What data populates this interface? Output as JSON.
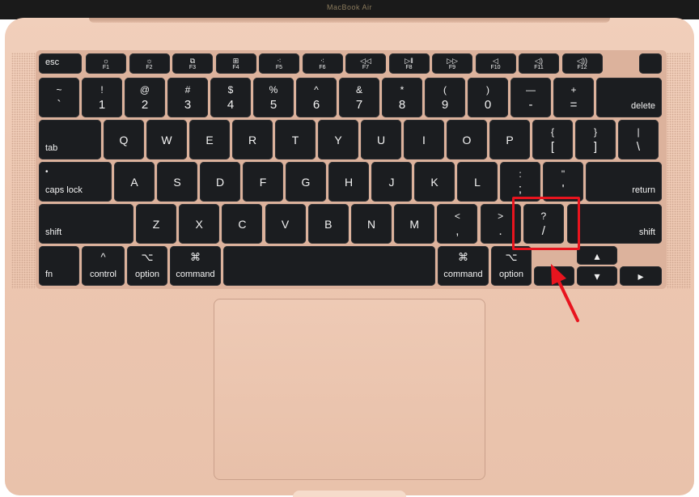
{
  "header": {
    "brand": "MacBook Air"
  },
  "colors": {
    "body": "#ecc6b0",
    "key": "#1b1d20",
    "annotation": "#e8141e"
  },
  "function_row": [
    {
      "id": "esc",
      "label": "esc"
    },
    {
      "id": "f1",
      "icon": "☼",
      "label": "F1"
    },
    {
      "id": "f2",
      "icon": "☼",
      "label": "F2"
    },
    {
      "id": "f3",
      "icon": "⧉",
      "label": "F3"
    },
    {
      "id": "f4",
      "icon": "⊞",
      "label": "F4"
    },
    {
      "id": "f5",
      "icon": "⁖",
      "label": "F5"
    },
    {
      "id": "f6",
      "icon": "⁖",
      "label": "F6"
    },
    {
      "id": "f7",
      "icon": "◁◁",
      "label": "F7"
    },
    {
      "id": "f8",
      "icon": "▷‖",
      "label": "F8"
    },
    {
      "id": "f9",
      "icon": "▷▷",
      "label": "F9"
    },
    {
      "id": "f10",
      "icon": "◁",
      "label": "F10"
    },
    {
      "id": "f11",
      "icon": "◁)",
      "label": "F11"
    },
    {
      "id": "f12",
      "icon": "◁))",
      "label": "F12"
    }
  ],
  "number_row": [
    {
      "id": "backtick",
      "top": "~",
      "bottom": "`"
    },
    {
      "id": "1",
      "top": "!",
      "bottom": "1"
    },
    {
      "id": "2",
      "top": "@",
      "bottom": "2"
    },
    {
      "id": "3",
      "top": "#",
      "bottom": "3"
    },
    {
      "id": "4",
      "top": "$",
      "bottom": "4"
    },
    {
      "id": "5",
      "top": "%",
      "bottom": "5"
    },
    {
      "id": "6",
      "top": "^",
      "bottom": "6"
    },
    {
      "id": "7",
      "top": "&",
      "bottom": "7"
    },
    {
      "id": "8",
      "top": "*",
      "bottom": "8"
    },
    {
      "id": "9",
      "top": "(",
      "bottom": "9"
    },
    {
      "id": "0",
      "top": ")",
      "bottom": "0"
    },
    {
      "id": "minus",
      "top": "—",
      "bottom": "-"
    },
    {
      "id": "equals",
      "top": "+",
      "bottom": "="
    },
    {
      "id": "delete",
      "label": "delete"
    }
  ],
  "qwerty_row": [
    {
      "id": "tab",
      "label": "tab"
    },
    {
      "id": "q",
      "label": "Q"
    },
    {
      "id": "w",
      "label": "W"
    },
    {
      "id": "e",
      "label": "E"
    },
    {
      "id": "r",
      "label": "R"
    },
    {
      "id": "t",
      "label": "T"
    },
    {
      "id": "y",
      "label": "Y"
    },
    {
      "id": "u",
      "label": "U"
    },
    {
      "id": "i",
      "label": "I"
    },
    {
      "id": "o",
      "label": "O"
    },
    {
      "id": "p",
      "label": "P"
    },
    {
      "id": "lbracket",
      "top": "{",
      "bottom": "["
    },
    {
      "id": "rbracket",
      "top": "}",
      "bottom": "]"
    },
    {
      "id": "backslash",
      "top": "|",
      "bottom": "\\"
    }
  ],
  "home_row": [
    {
      "id": "capslock",
      "dot": "•",
      "label": "caps lock"
    },
    {
      "id": "a",
      "label": "A"
    },
    {
      "id": "s",
      "label": "S"
    },
    {
      "id": "d",
      "label": "D"
    },
    {
      "id": "f",
      "label": "F"
    },
    {
      "id": "g",
      "label": "G"
    },
    {
      "id": "h",
      "label": "H"
    },
    {
      "id": "j",
      "label": "J"
    },
    {
      "id": "k",
      "label": "K"
    },
    {
      "id": "l",
      "label": "L"
    },
    {
      "id": "semicolon",
      "top": ":",
      "bottom": ";"
    },
    {
      "id": "quote",
      "top": "\"",
      "bottom": "'"
    },
    {
      "id": "return",
      "label": "return"
    }
  ],
  "shift_row": [
    {
      "id": "lshift",
      "label": "shift"
    },
    {
      "id": "z",
      "label": "Z"
    },
    {
      "id": "x",
      "label": "X"
    },
    {
      "id": "c",
      "label": "C"
    },
    {
      "id": "v",
      "label": "V"
    },
    {
      "id": "b",
      "label": "B"
    },
    {
      "id": "n",
      "label": "N"
    },
    {
      "id": "m",
      "label": "M"
    },
    {
      "id": "comma",
      "top": "<",
      "bottom": ","
    },
    {
      "id": "period",
      "top": ">",
      "bottom": "."
    },
    {
      "id": "slash",
      "top": "?",
      "bottom": "/"
    },
    {
      "id": "rshift",
      "label": "shift"
    }
  ],
  "bottom_row": [
    {
      "id": "fn",
      "label": "fn"
    },
    {
      "id": "lcontrol",
      "symbol": "^",
      "label": "control"
    },
    {
      "id": "loption",
      "symbol": "⌥",
      "label": "option"
    },
    {
      "id": "lcommand",
      "symbol": "⌘",
      "label": "command"
    },
    {
      "id": "space",
      "label": ""
    },
    {
      "id": "rcommand",
      "symbol": "⌘",
      "label": "command"
    },
    {
      "id": "roption",
      "symbol": "⌥",
      "label": "option"
    },
    {
      "id": "left",
      "symbol": "◂"
    },
    {
      "id": "up",
      "symbol": "▴"
    },
    {
      "id": "down",
      "symbol": "▾"
    },
    {
      "id": "right",
      "symbol": "▸"
    }
  ],
  "annotation": {
    "target": "slash",
    "shape": "rectangle-and-arrow"
  }
}
